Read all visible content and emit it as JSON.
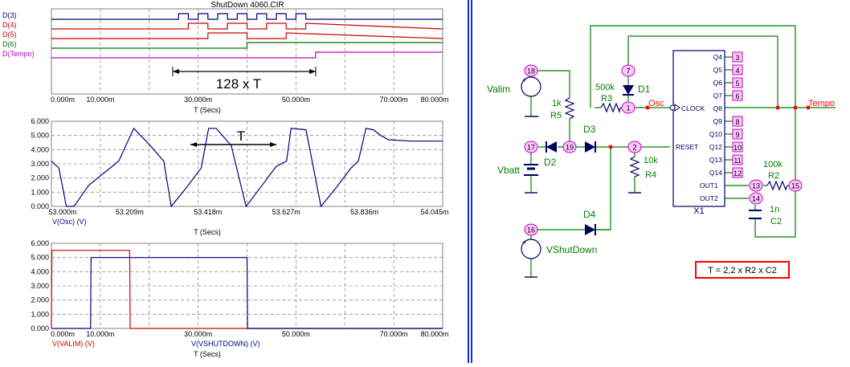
{
  "title": "ShutDown 4060.CIR",
  "colors": {
    "blue": "#000080",
    "red": "#d00000",
    "green": "#007000",
    "magenta": "#c000c0",
    "circuit_green": "#008000",
    "circuit_dark_blue": "#000060",
    "circuit_red": "#ff0000",
    "pink_fill": "#ffc8ff",
    "pink_stroke": "#c000c0",
    "formula_red": "#ff0000",
    "divider_blue": "#1030d0"
  },
  "panel1": {
    "signals": [
      "D(3)",
      "D(4)",
      "D(5)",
      "D(6)",
      "D(Tempo)"
    ],
    "annotation": "128 x T",
    "x_ticks": [
      "0.000m",
      "10.000m",
      "30.000m",
      "50.000m",
      "70.000m",
      "80.000m"
    ],
    "x_axis_label": "T (Secs)"
  },
  "panel2": {
    "annotation": "T",
    "y_ticks": [
      "6.000",
      "5.000",
      "4.000",
      "3.000",
      "2.000",
      "1.000",
      "0.000"
    ],
    "x_ticks": [
      "53.000m",
      "53.209m",
      "53.418m",
      "53.627m",
      "53.836m",
      "54.045m"
    ],
    "trace_label": "V(Osc) (V)",
    "x_axis_label": "T (Secs)"
  },
  "panel3": {
    "y_ticks": [
      "6.000",
      "5.000",
      "4.000",
      "3.000",
      "2.000",
      "1.000",
      "0.000"
    ],
    "x_ticks": [
      "0.000m",
      "10.000m",
      "30.000m",
      "50.000m",
      "70.000m",
      "80.000m"
    ],
    "trace_labels": [
      "V(VALIM) (V)",
      "V(VSHUTDOWN) (V)"
    ],
    "x_axis_label": "T (Secs)"
  },
  "chart_data": [
    {
      "type": "line",
      "title": "ShutDown 4060.CIR",
      "xlabel": "T (Secs)",
      "xlim": [
        0,
        80
      ],
      "series": [
        {
          "name": "D(3)",
          "x": [
            0,
            26,
            26,
            28,
            28,
            30,
            30,
            32,
            32,
            34,
            34,
            36,
            36,
            38,
            38,
            40,
            40,
            42,
            42,
            44,
            44,
            46,
            46,
            48,
            48,
            50,
            50,
            52,
            52,
            54,
            54,
            80
          ],
          "values": [
            0,
            0,
            1,
            1,
            0,
            0,
            1,
            1,
            0,
            0,
            1,
            1,
            0,
            0,
            1,
            1,
            0,
            0,
            1,
            1,
            0,
            0,
            1,
            1,
            0,
            0,
            1,
            1,
            0,
            0,
            0,
            0
          ]
        },
        {
          "name": "D(4)",
          "x": [
            0,
            28,
            28,
            32,
            32,
            36,
            36,
            40,
            40,
            44,
            44,
            48,
            48,
            52,
            52,
            80
          ],
          "values": [
            0,
            0,
            1,
            1,
            0,
            0,
            1,
            1,
            0,
            0,
            1,
            1,
            0,
            0,
            1,
            0
          ]
        },
        {
          "name": "D(5)",
          "x": [
            0,
            32,
            32,
            40,
            40,
            48,
            48,
            80
          ],
          "values": [
            0,
            0,
            1,
            1,
            0,
            0,
            1,
            0
          ]
        },
        {
          "name": "D(6)",
          "x": [
            0,
            40,
            40,
            80
          ],
          "values": [
            0,
            0,
            1,
            1
          ]
        },
        {
          "name": "D(Tempo)",
          "x": [
            0,
            54,
            54,
            80
          ],
          "values": [
            0,
            0,
            1,
            1
          ]
        }
      ]
    },
    {
      "type": "line",
      "xlabel": "T (Secs)",
      "ylabel": "V(Osc) (V)",
      "xlim": [
        53.0,
        54.045
      ],
      "ylim": [
        0,
        6
      ],
      "series": [
        {
          "name": "V(Osc) (V)",
          "x": [
            53.0,
            53.02,
            53.04,
            53.06,
            53.1,
            53.18,
            53.22,
            53.26,
            53.3,
            53.32,
            53.36,
            53.4,
            53.42,
            53.44,
            53.48,
            53.52,
            53.56,
            53.6,
            53.628,
            53.64,
            53.68,
            53.72,
            53.76,
            53.8,
            53.82,
            53.84,
            53.86,
            53.88,
            53.9,
            53.96,
            54.045
          ],
          "values": [
            3.2,
            2.7,
            0,
            0,
            1.5,
            3.2,
            5.5,
            4.4,
            3.2,
            0,
            1.3,
            2.7,
            5.5,
            5.5,
            4.3,
            0,
            1.4,
            2.8,
            3.2,
            5.5,
            5.4,
            0,
            1.3,
            2.7,
            3.2,
            5.5,
            5.4,
            5.0,
            4.7,
            4.6,
            4.6
          ]
        }
      ]
    },
    {
      "type": "line",
      "xlabel": "T (Secs)",
      "xlim": [
        0,
        80
      ],
      "ylim": [
        0,
        6
      ],
      "series": [
        {
          "name": "V(VALIM) (V)",
          "x": [
            0,
            0.1,
            16,
            16.1,
            80
          ],
          "values": [
            0,
            5.5,
            5.5,
            0,
            0
          ]
        },
        {
          "name": "V(VSHUTDOWN) (V)",
          "x": [
            0,
            8,
            8.1,
            40,
            40.1,
            80
          ],
          "values": [
            0,
            0,
            5,
            5,
            0,
            0
          ]
        }
      ]
    }
  ],
  "circuit": {
    "components": {
      "valim": "Valim",
      "vbatt": "Vbatt",
      "vshutdown": "VShutDown",
      "r5_value": "1k",
      "r5_name": "R5",
      "r3_value": "500k",
      "r3_name": "R3",
      "d1": "D1",
      "d2": "D2",
      "d3": "D3",
      "d4": "D4",
      "r4_value": "10k",
      "r4_name": "R4",
      "r2_value": "100k",
      "r2_name": "R2",
      "c2_value": "1n",
      "c2_name": "C2",
      "ic": "X1"
    },
    "nodes": {
      "osc": "Osc",
      "tempo": "Tempo"
    },
    "node_numbers": [
      "18",
      "17",
      "16",
      "19",
      "7",
      "1",
      "2",
      "13",
      "14",
      "15"
    ],
    "ic_pins_left": [
      "CLOCK",
      "RESET",
      "OUT1",
      "OUT2"
    ],
    "ic_pins_right": [
      "Q4",
      "Q5",
      "Q6",
      "Q7",
      "Q8",
      "Q9",
      "Q10",
      "Q12",
      "Q13",
      "Q14"
    ],
    "ic_pin_numbers": [
      "3",
      "4",
      "5",
      "6",
      "8",
      "9",
      "10",
      "11",
      "12"
    ],
    "formula": "T = 2,2 x R2 x C2"
  }
}
